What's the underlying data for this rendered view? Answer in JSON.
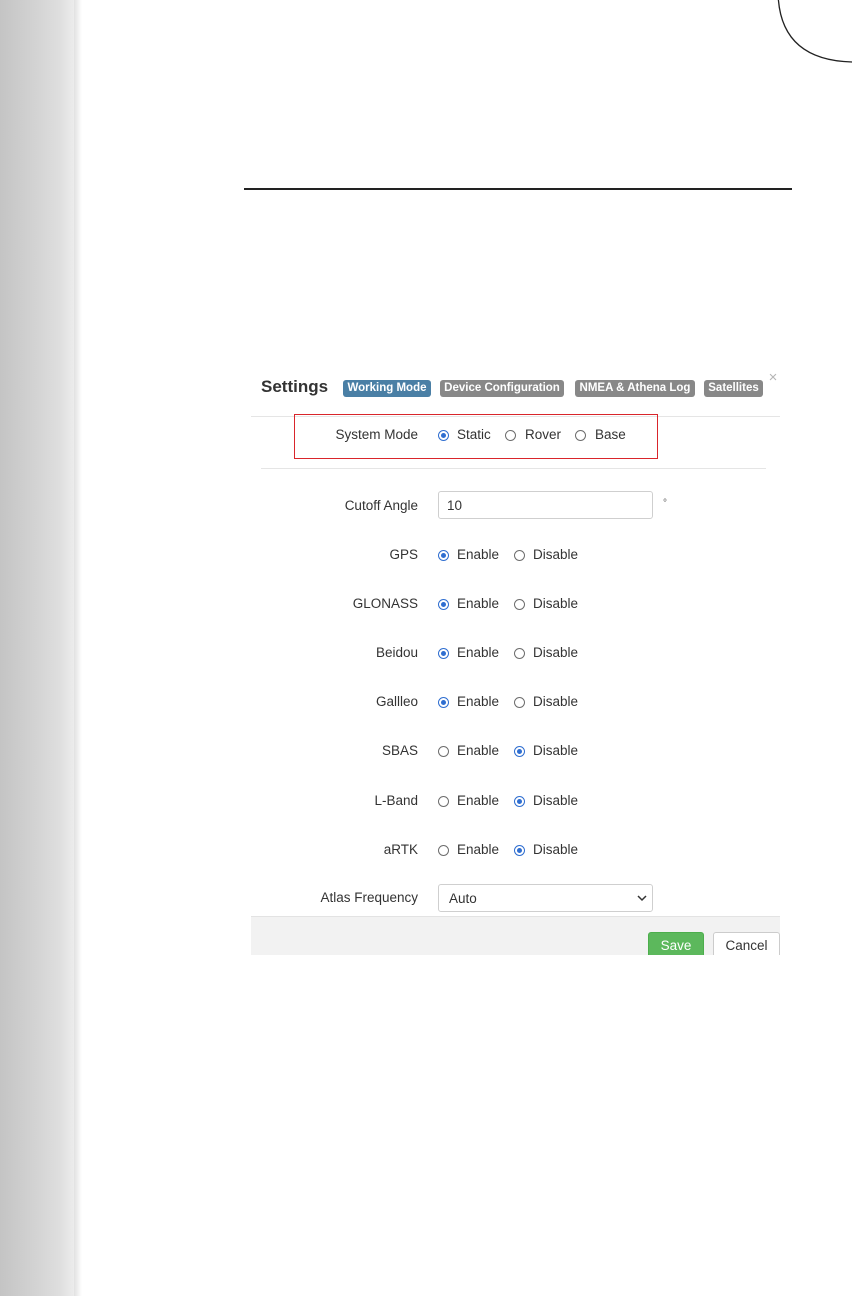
{
  "dialog": {
    "title": "Settings",
    "tabs": [
      {
        "label": "Working Mode",
        "active": true
      },
      {
        "label": "Device Configuration",
        "active": false
      },
      {
        "label": "NMEA & Athena Log",
        "active": false
      },
      {
        "label": "Satellites",
        "active": false
      }
    ],
    "close_glyph": "×"
  },
  "system_mode": {
    "label": "System Mode",
    "options": [
      "Static",
      "Rover",
      "Base"
    ],
    "selected": "Static"
  },
  "cutoff_angle": {
    "label": "Cutoff Angle",
    "value": "10",
    "unit": "°"
  },
  "constellations": [
    {
      "label": "GPS",
      "enable_label": "Enable",
      "disable_label": "Disable",
      "selected": "Enable"
    },
    {
      "label": "GLONASS",
      "enable_label": "Enable",
      "disable_label": "Disable",
      "selected": "Enable"
    },
    {
      "label": "Beidou",
      "enable_label": "Enable",
      "disable_label": "Disable",
      "selected": "Enable"
    },
    {
      "label": "Gallleo",
      "enable_label": "Enable",
      "disable_label": "Disable",
      "selected": "Enable"
    },
    {
      "label": "SBAS",
      "enable_label": "Enable",
      "disable_label": "Disable",
      "selected": "Disable"
    },
    {
      "label": "L-Band",
      "enable_label": "Enable",
      "disable_label": "Disable",
      "selected": "Disable"
    },
    {
      "label": "aRTK",
      "enable_label": "Enable",
      "disable_label": "Disable",
      "selected": "Disable"
    }
  ],
  "atlas_frequency": {
    "label": "Atlas Frequency",
    "selected": "Auto"
  },
  "footer": {
    "save_label": "Save",
    "cancel_label": "Cancel"
  },
  "colors": {
    "active_tab": "#4a7fa5",
    "inactive_tab": "#888888",
    "radio_checked": "#2f6ed0",
    "highlight_box": "#d9252b",
    "save_button": "#5cb85c"
  },
  "icons": {
    "close": "close-icon",
    "dropdown": "chevron-down-icon"
  }
}
